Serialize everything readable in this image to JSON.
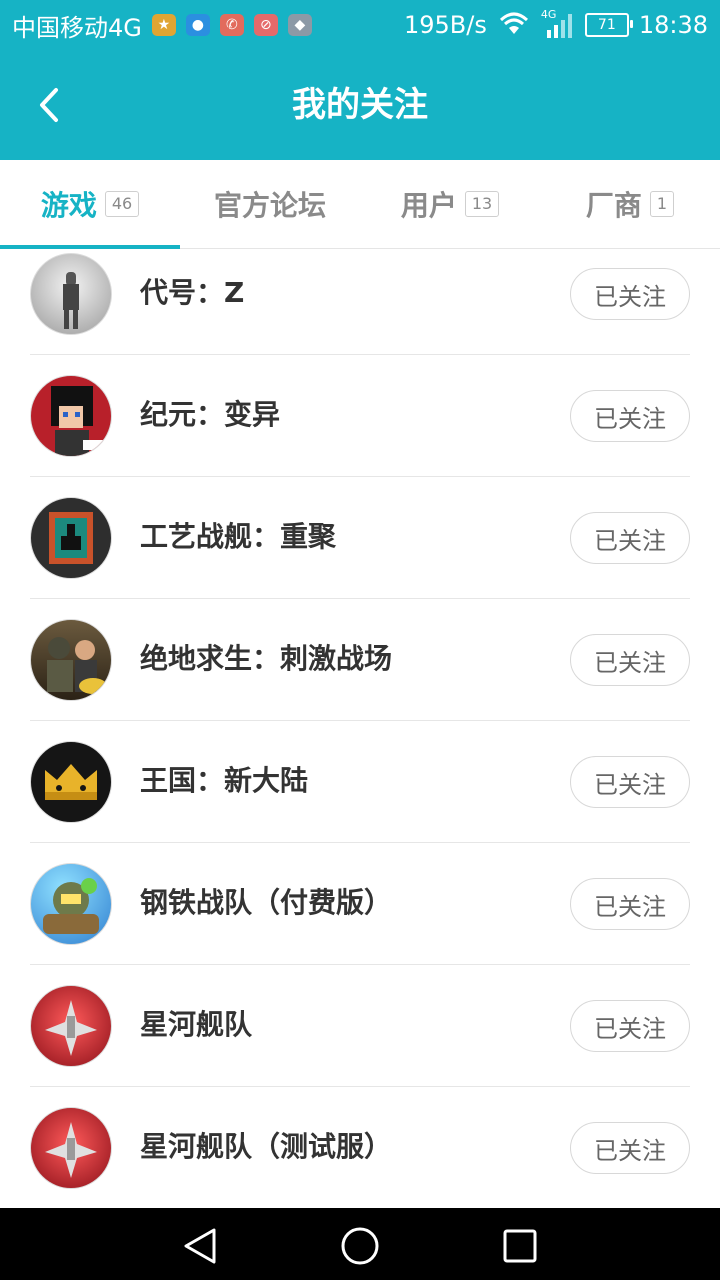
{
  "status_bar": {
    "carrier": "中国移动4G",
    "speed": "195B/s",
    "network": "4G",
    "battery": "71",
    "time": "18:38"
  },
  "header": {
    "back_icon": "chevron-left-icon",
    "title": "我的关注"
  },
  "tabs": [
    {
      "label": "游戏",
      "count": "46",
      "active": true
    },
    {
      "label": "官方论坛",
      "count": "",
      "active": false
    },
    {
      "label": "用户",
      "count": "13",
      "active": false
    },
    {
      "label": "厂商",
      "count": "1",
      "active": false
    }
  ],
  "games": [
    {
      "name": "代号：Z",
      "follow_label": "已关注"
    },
    {
      "name": "纪元：变异",
      "follow_label": "已关注"
    },
    {
      "name": "工艺战舰：重聚",
      "follow_label": "已关注"
    },
    {
      "name": "绝地求生：刺激战场",
      "follow_label": "已关注"
    },
    {
      "name": "王国：新大陆",
      "follow_label": "已关注"
    },
    {
      "name": "钢铁战队（付费版）",
      "follow_label": "已关注"
    },
    {
      "name": "星河舰队",
      "follow_label": "已关注"
    },
    {
      "name": "星河舰队（测试服）",
      "follow_label": "已关注"
    }
  ],
  "colors": {
    "accent": "#16b3c5"
  }
}
